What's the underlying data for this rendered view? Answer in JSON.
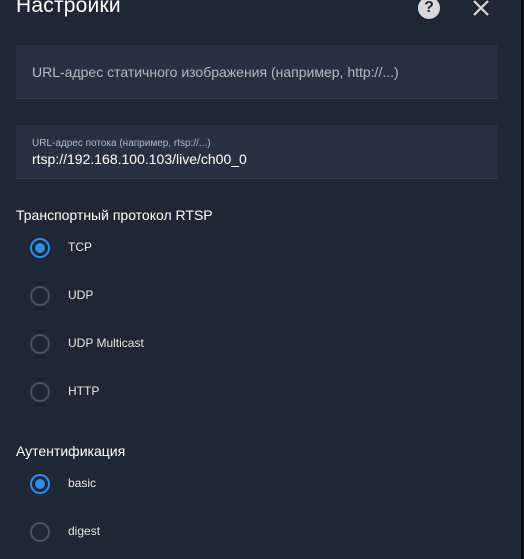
{
  "dialog": {
    "title": "Настройки",
    "help_icon": "?"
  },
  "still_image_field": {
    "placeholder": "URL-адрес статичного изображения (например, http://...)",
    "value": ""
  },
  "stream_field": {
    "label": "URL-адрес потока (например, rtsp://...)",
    "value": "rtsp://192.168.100.103/live/ch00_0"
  },
  "transport": {
    "title": "Транспортный протокол RTSP",
    "options": [
      {
        "label": "TCP",
        "selected": true
      },
      {
        "label": "UDP",
        "selected": false
      },
      {
        "label": "UDP Multicast",
        "selected": false
      },
      {
        "label": "HTTP",
        "selected": false
      }
    ]
  },
  "auth": {
    "title": "Аутентификация",
    "options": [
      {
        "label": "basic",
        "selected": true
      },
      {
        "label": "digest",
        "selected": false
      }
    ]
  },
  "colors": {
    "background": "#1f2735",
    "field": "#283142",
    "accent": "#2d8cf0"
  }
}
